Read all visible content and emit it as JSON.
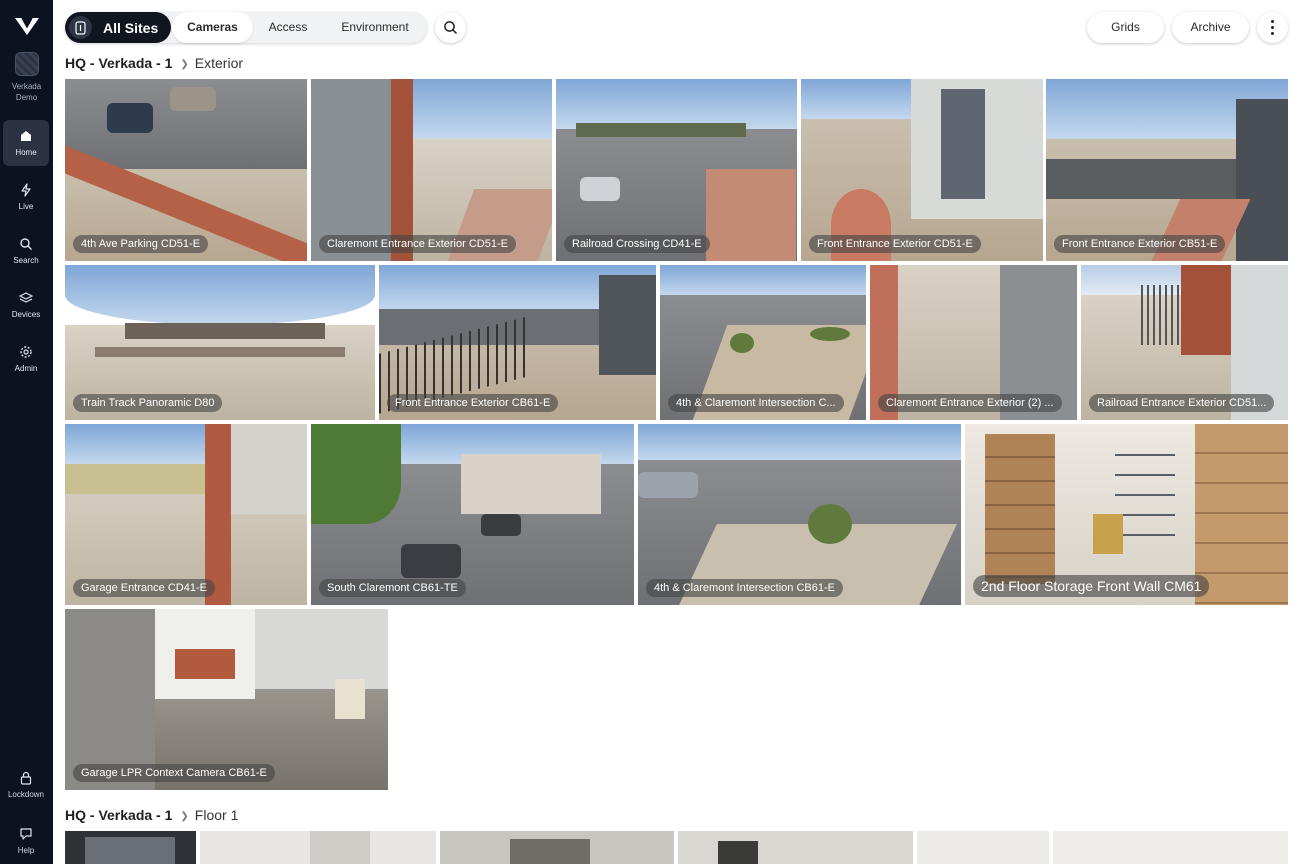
{
  "sidebar": {
    "org_name_line1": "Verkada",
    "org_name_line2": "Demo",
    "nav": [
      {
        "label": "Home",
        "icon": "home-icon",
        "active": true
      },
      {
        "label": "Live",
        "icon": "bolt-icon",
        "active": false
      },
      {
        "label": "Search",
        "icon": "search-icon",
        "active": false
      },
      {
        "label": "Devices",
        "icon": "devices-icon",
        "active": false
      },
      {
        "label": "Admin",
        "icon": "gear-icon",
        "active": false
      }
    ],
    "bottom": [
      {
        "label": "Lockdown",
        "icon": "lock-icon"
      },
      {
        "label": "Help",
        "icon": "chat-icon"
      }
    ]
  },
  "topbar": {
    "all_sites": "All Sites",
    "tabs": [
      "Cameras",
      "Access",
      "Environment"
    ],
    "active_tab": "Cameras",
    "grids": "Grids",
    "archive": "Archive"
  },
  "sections": [
    {
      "site": "HQ - Verkada - 1",
      "area": "Exterior"
    },
    {
      "site": "HQ - Verkada - 1",
      "area": "Floor 1"
    }
  ],
  "cameras": [
    "4th Ave Parking CD51-E",
    "Claremont Entrance Exterior CD51-E",
    "Railroad Crossing CD41-E",
    "Front Entrance Exterior CD51-E",
    "Front Entrance Exterior CB51-E",
    "Train Track Panoramic D80",
    "Front Entrance Exterior CB61-E",
    "4th & Claremont Intersection C...",
    "Claremont Entrance Exterior (2) ...",
    "Railroad Entrance Exterior CD51...",
    "Garage Entrance CD41-E",
    "South Claremont CB61-TE",
    "4th & Claremont Intersection CB61-E",
    "2nd Floor Storage Front Wall CM61",
    "Garage LPR Context Camera CB61-E"
  ],
  "colors": {
    "sidebar_bg": "#0b1220",
    "active_pill": "#10151f",
    "caption_bg": "rgba(70,70,70,0.62)"
  }
}
